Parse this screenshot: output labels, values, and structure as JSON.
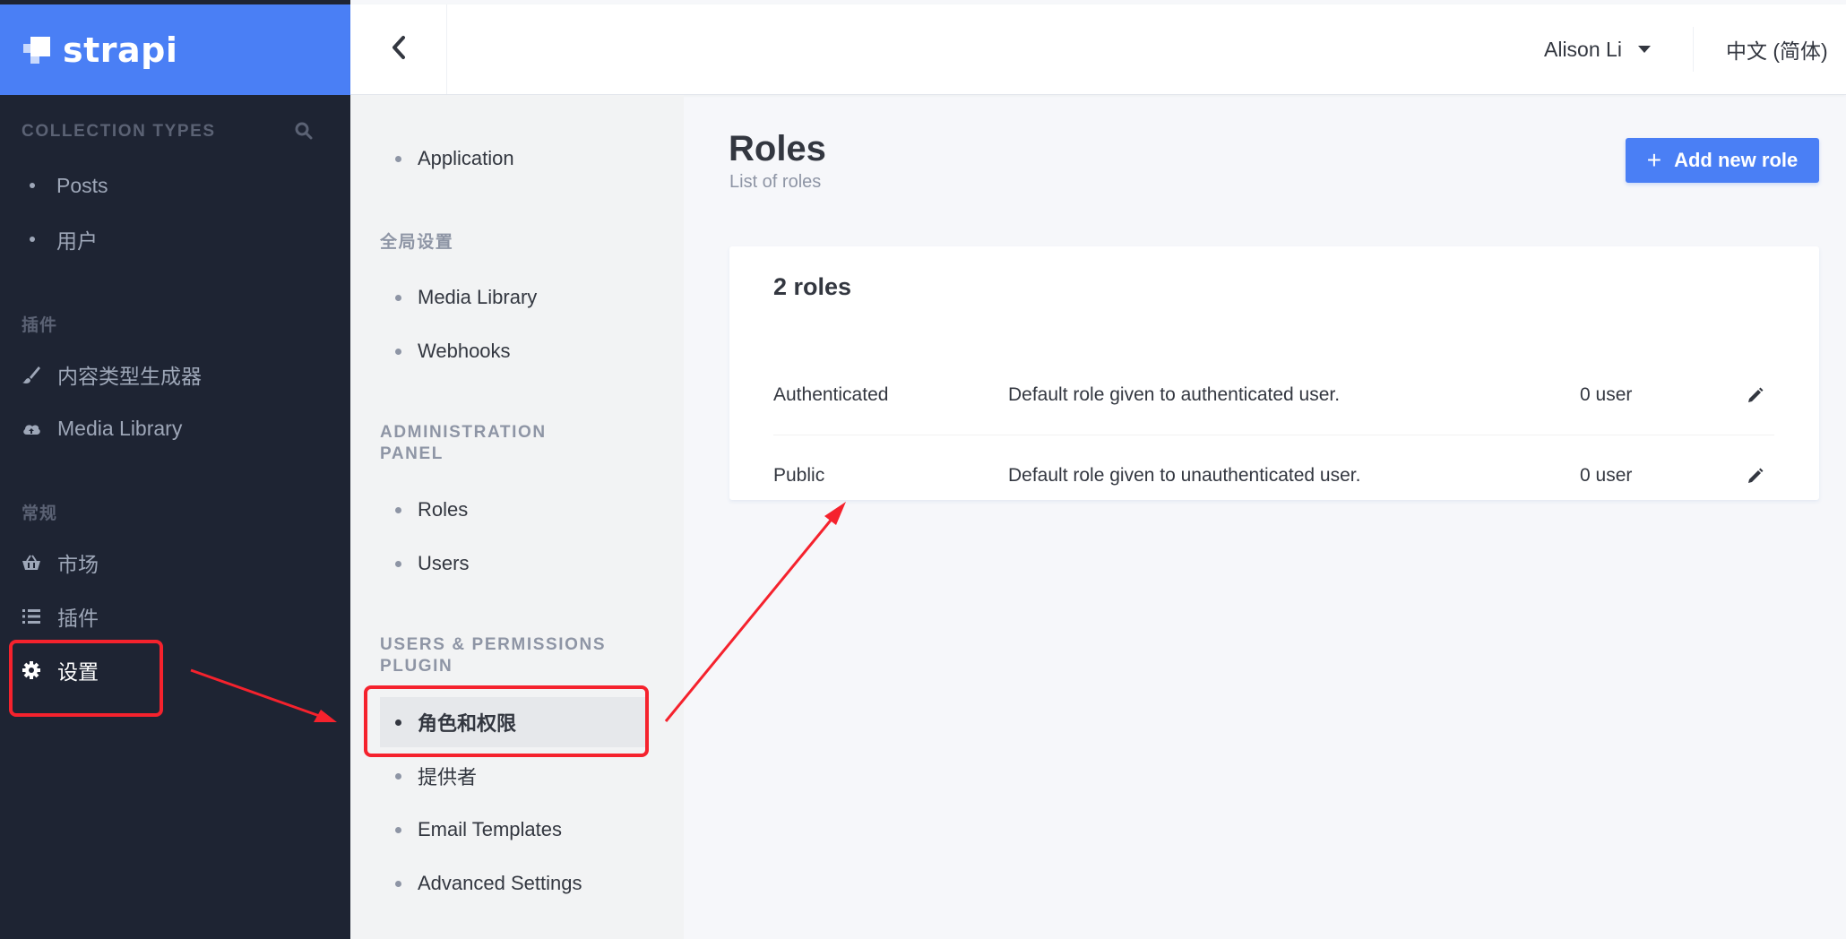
{
  "brand": {
    "name": "strapi",
    "color": "#4a7ff5"
  },
  "sidebar": {
    "bg_color": "#1e2433",
    "collection_types_heading": "COLLECTION TYPES",
    "collection_items": [
      {
        "label": "Posts"
      },
      {
        "label": "用户"
      }
    ],
    "plugins_heading": "插件",
    "plugin_items": [
      {
        "label": "内容类型生成器",
        "icon": "paint-brush-icon"
      },
      {
        "label": "Media Library",
        "icon": "cloud-upload-icon"
      }
    ],
    "general_heading": "常规",
    "general_items": [
      {
        "label": "市场",
        "icon": "shopping-basket-icon"
      },
      {
        "label": "插件",
        "icon": "list-icon"
      },
      {
        "label": "设置",
        "icon": "gear-icon",
        "active": true
      }
    ]
  },
  "header": {
    "user_name": "Alison Li",
    "language": "中文 (简体)"
  },
  "settings_nav": {
    "top_items": [
      {
        "label": "Application"
      }
    ],
    "global_heading": "全局设置",
    "global_items": [
      {
        "label": "Media Library"
      },
      {
        "label": "Webhooks"
      }
    ],
    "admin_heading_line1": "ADMINISTRATION",
    "admin_heading_line2": "PANEL",
    "admin_items": [
      {
        "label": "Roles"
      },
      {
        "label": "Users"
      }
    ],
    "plugin_heading_line1": "USERS & PERMISSIONS",
    "plugin_heading_line2": "PLUGIN",
    "plugin_items": [
      {
        "label": "角色和权限",
        "active": true
      },
      {
        "label": "提供者"
      },
      {
        "label": "Email Templates"
      },
      {
        "label": "Advanced Settings"
      }
    ]
  },
  "main": {
    "title": "Roles",
    "subtitle": "List of roles",
    "add_button_label": "Add new role",
    "roles_count_label": "2 roles",
    "roles": [
      {
        "name": "Authenticated",
        "description": "Default role given to authenticated user.",
        "users": "0 user"
      },
      {
        "name": "Public",
        "description": "Default role given to unauthenticated user.",
        "users": "0 user"
      }
    ]
  },
  "annotation_color": "#f5222d"
}
